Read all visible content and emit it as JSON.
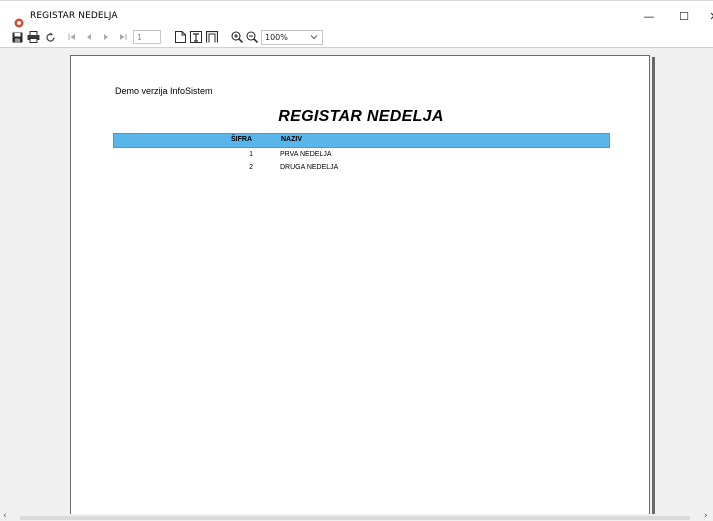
{
  "window": {
    "title": "REGISTAR NEDELJA",
    "controls": {
      "minimize": "—",
      "maximize": "☐",
      "close": "✕"
    }
  },
  "toolbar": {
    "page_number": "1",
    "zoom_value": "100%",
    "icons": [
      "save-icon",
      "print-icon",
      "refresh-icon",
      "first-page-icon",
      "previous-page-icon",
      "next-page-icon",
      "last-page-icon",
      "single-page-icon",
      "page-width-icon",
      "whole-page-icon",
      "zoom-in-icon",
      "zoom-out-icon"
    ]
  },
  "report": {
    "demo_text": "Demo verzija InfoSistem",
    "title": "REGISTAR NEDELJA",
    "columns": {
      "sifra": "ŠIFRA",
      "naziv": "NAZIV"
    },
    "rows": [
      {
        "sifra": "1",
        "naziv": "PRVA NEDELJA"
      },
      {
        "sifra": "2",
        "naziv": "DRUGA NEDELJA"
      }
    ],
    "header_color": "#5ab6ea"
  },
  "scrollbar": {
    "left_arrow": "‹",
    "right_arrow": "›"
  }
}
